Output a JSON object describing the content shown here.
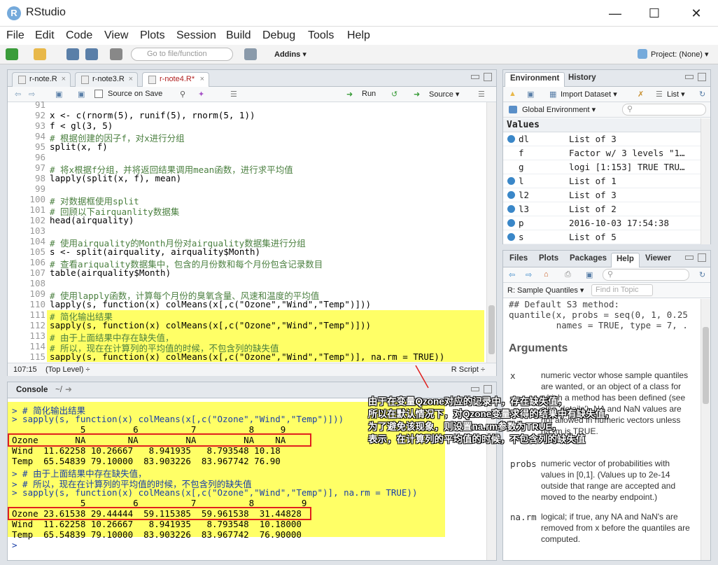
{
  "window": {
    "title": "RStudio"
  },
  "menu": [
    "File",
    "Edit",
    "Code",
    "View",
    "Plots",
    "Session",
    "Build",
    "Debug",
    "Tools",
    "Help"
  ],
  "toolbar": {
    "goto_placeholder": "Go to file/function",
    "addins": "Addins ▾",
    "project": "Project: (None) ▾"
  },
  "editor": {
    "tabs": [
      "r-note.R",
      "r-note3.R",
      "r-note4.R*"
    ],
    "source_on_save": "Source on Save",
    "run": "Run",
    "source": "Source ▾",
    "lines": [
      {
        "n": "91",
        "t": ""
      },
      {
        "n": "92",
        "t": "x <- c(rnorm(5), runif(5), rnorm(5, 1))"
      },
      {
        "n": "93",
        "t": "f < gl(3, 5)"
      },
      {
        "n": "94",
        "t": "# 根据创建的因子f，对x进行分组"
      },
      {
        "n": "95",
        "t": "split(x, f)"
      },
      {
        "n": "96",
        "t": ""
      },
      {
        "n": "97",
        "t": "# 将x根据f分组，并将返回结果调用mean函数，进行求平均值"
      },
      {
        "n": "98",
        "t": "lapply(split(x, f), mean)"
      },
      {
        "n": "99",
        "t": ""
      },
      {
        "n": "100",
        "t": "# 对数据框使用split"
      },
      {
        "n": "101",
        "t": "# 回顾以下airquanlity数据集"
      },
      {
        "n": "102",
        "t": "head(airquality)"
      },
      {
        "n": "103",
        "t": ""
      },
      {
        "n": "104",
        "t": "# 使用airquality的Month月份对airquality数据集进行分组"
      },
      {
        "n": "105",
        "t": "s <- split(airquality, airquality$Month)"
      },
      {
        "n": "106",
        "t": "# 查看ariquality数据集中，包含的月份数和每个月份包含记录数目"
      },
      {
        "n": "107",
        "t": "table(airquality$Month)"
      },
      {
        "n": "108",
        "t": ""
      },
      {
        "n": "109",
        "t": "# 使用lapply函数，计算每个月份的臭氧含量、风速和温度的平均值"
      },
      {
        "n": "110",
        "t": "lapply(s, function(x) colMeans(x[,c(\"Ozone\",\"Wind\",\"Temp\")]))"
      },
      {
        "n": "111",
        "t": "# 简化输出结果"
      },
      {
        "n": "112",
        "t": "sapply(s, function(x) colMeans(x[,c(\"Ozone\",\"Wind\",\"Temp\")]))"
      },
      {
        "n": "113",
        "t": "# 由于上面结果中存在缺失值，"
      },
      {
        "n": "114",
        "t": "# 所以，现在在计算列的平均值的时候，不包含列的缺失值"
      },
      {
        "n": "115",
        "t": "sapply(s, function(x) colMeans(x[,c(\"Ozone\",\"Wind\",\"Temp\")], na.rm = TRUE))"
      }
    ],
    "status_pos": "107:15",
    "status_level": "(Top Level) ÷",
    "status_type": "R Script ÷"
  },
  "console": {
    "title": "Console",
    "path": "~/",
    "lines": [
      "> # 简化输出结果",
      "> sapply(s, function(x) colMeans(x[,c(\"Ozone\",\"Wind\",\"Temp\")]))",
      "             5         6          7          8     9",
      "Ozone       NA        NA         NA         NA    NA",
      "Wind  11.62258 10.26667   8.941935   8.793548 10.18",
      "Temp  65.54839 79.10000  83.903226  83.967742 76.90",
      "> # 由于上面结果中存在缺失值，",
      "> # 所以，现在在计算列的平均值的时候，不包含列的缺失值",
      "> sapply(s, function(x) colMeans(x[,c(\"Ozone\",\"Wind\",\"Temp\")], na.rm = TRUE))",
      "             5         6          7          8         9",
      "Ozone 23.61538 29.44444  59.115385  59.961538  31.44828",
      "Wind  11.62258 10.26667   8.941935   8.793548  10.18000",
      "Temp  65.54839 79.10000  83.903226  83.967742  76.90000",
      "> "
    ]
  },
  "annotation": [
    "由于在变量Qzone对应的记录中，存在缺失值，",
    "所以在默认情况下，对Qzone变量求得的结果中有缺失值，",
    "为了避免该现象，则设置na.rm参数为TRUE，",
    "表示，在计算列的平均值的时候，不包含列的缺失值"
  ],
  "env": {
    "tabs": [
      "Environment",
      "History"
    ],
    "import": "Import Dataset ▾",
    "list": "List ▾",
    "scope": "Global Environment ▾",
    "section": "Values",
    "rows": [
      {
        "name": "dl",
        "value": "List of 3",
        "btn": true
      },
      {
        "name": "f",
        "value": "Factor w/ 3 levels \"1…",
        "btn": false
      },
      {
        "name": "g",
        "value": "logi [1:153] TRUE TRU…",
        "btn": false
      },
      {
        "name": "l",
        "value": "List of 1",
        "btn": true
      },
      {
        "name": "l2",
        "value": "List of 3",
        "btn": true
      },
      {
        "name": "l3",
        "value": "List of 2",
        "btn": true
      },
      {
        "name": "p",
        "value": "2016-10-03 17:54:38",
        "btn": true
      },
      {
        "name": "s",
        "value": "List of 5",
        "btn": true
      }
    ]
  },
  "help": {
    "tabs": [
      "Files",
      "Plots",
      "Packages",
      "Help",
      "Viewer"
    ],
    "topic": "R: Sample Quantiles ▾",
    "find_placeholder": "Find in Topic",
    "code1": "## Default S3 method:",
    "code2": "quantile(x, probs = seq(0, 1, 0.25",
    "code3": "         names = TRUE, type = 7, .",
    "heading": "Arguments",
    "args": [
      {
        "name": "x",
        "desc": "numeric vector whose sample quantiles are wanted, or an object of a class for which a method has been defined (see also 'details'). NA and NaN values are not allowed in numeric vectors unless na.rm is TRUE."
      },
      {
        "name": "probs",
        "desc": "numeric vector of probabilities with values in [0,1]. (Values up to 2e-14 outside that range are accepted and moved to the nearby endpoint.)"
      },
      {
        "name": "na.rm",
        "desc": "logical; if true, any NA and NaN's are removed from x before the quantiles are computed."
      }
    ]
  }
}
